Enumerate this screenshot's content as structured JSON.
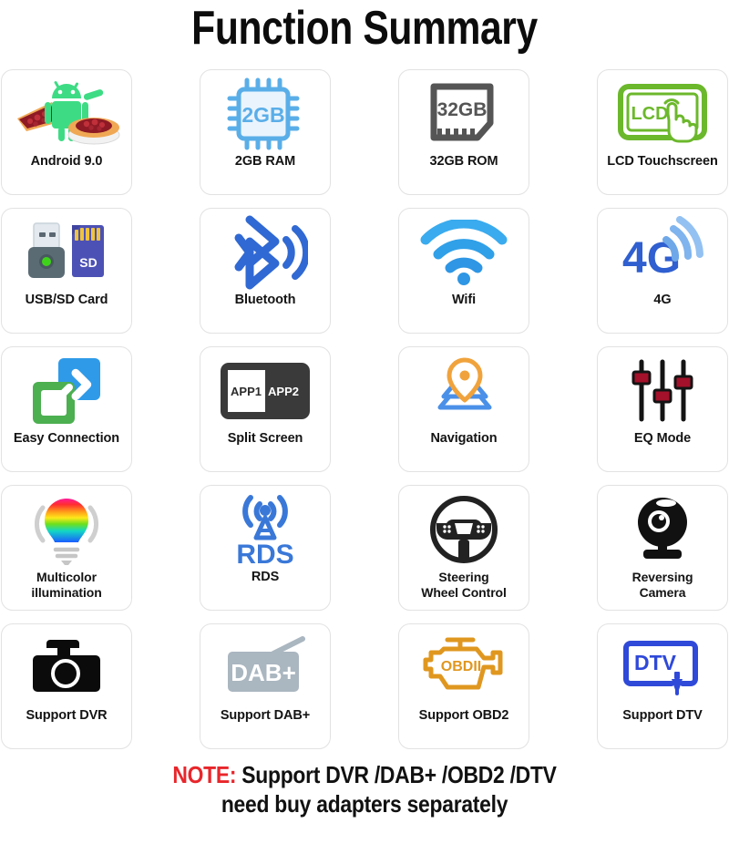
{
  "header": {
    "title": "Function Summary"
  },
  "features": [
    {
      "id": "android",
      "icon": "android-pie-icon",
      "label": "Android 9.0",
      "icon_text": "",
      "color": "#3ddc84"
    },
    {
      "id": "ram",
      "icon": "cpu-chip-icon",
      "label": "2GB RAM",
      "icon_text": "2GB",
      "color": "#5aaee8"
    },
    {
      "id": "rom",
      "icon": "sd-card-icon",
      "label": "32GB ROM",
      "icon_text": "32GB",
      "color": "#555555"
    },
    {
      "id": "lcd",
      "icon": "lcd-touchscreen-icon",
      "label": "LCD Touchscreen",
      "icon_text": "LCD",
      "color": "#6cb82c"
    },
    {
      "id": "usbsd",
      "icon": "usb-sd-card-icon",
      "label": "USB/SD Card",
      "icon_text": "SD",
      "color": "#4c51b5"
    },
    {
      "id": "bluetooth",
      "icon": "bluetooth-icon",
      "label": "Bluetooth",
      "icon_text": "",
      "color": "#3069d3"
    },
    {
      "id": "wifi",
      "icon": "wifi-icon",
      "label": "Wifi",
      "icon_text": "",
      "color": "#30a0e8"
    },
    {
      "id": "4g",
      "icon": "4g-signal-icon",
      "label": "4G",
      "icon_text": "4G",
      "color": "#2f5fd0"
    },
    {
      "id": "easyconn",
      "icon": "easy-connection-icon",
      "label": "Easy Connection",
      "icon_text": "",
      "color": "#4caf50"
    },
    {
      "id": "split",
      "icon": "split-screen-icon",
      "label": "Split Screen",
      "icon_text": "APP1 APP2",
      "color": "#3a3a3a"
    },
    {
      "id": "navigation",
      "icon": "navigation-pin-icon",
      "label": "Navigation",
      "icon_text": "",
      "color": "#f0a33c"
    },
    {
      "id": "eq",
      "icon": "eq-sliders-icon",
      "label": "EQ Mode",
      "icon_text": "",
      "color": "#a4112a"
    },
    {
      "id": "multicolor",
      "icon": "multicolor-bulb-icon",
      "label": "Multicolor\nillumination",
      "icon_text": "",
      "color": "#ff2fa0"
    },
    {
      "id": "rds",
      "icon": "rds-tower-icon",
      "label": "RDS",
      "icon_text": "RDS",
      "color": "#3a78d8"
    },
    {
      "id": "steering",
      "icon": "steering-wheel-icon",
      "label": "Steering\nWheel Control",
      "icon_text": "",
      "color": "#222222"
    },
    {
      "id": "reversing",
      "icon": "reversing-camera-icon",
      "label": "Reversing\nCamera",
      "icon_text": "",
      "color": "#111111"
    },
    {
      "id": "dvr",
      "icon": "dvr-dashcam-icon",
      "label": "Support DVR",
      "icon_text": "",
      "color": "#0b0b0b"
    },
    {
      "id": "dab",
      "icon": "dab-radio-icon",
      "label": "Support DAB+",
      "icon_text": "DAB+",
      "color": "#aab6c0"
    },
    {
      "id": "obd2",
      "icon": "obd2-engine-icon",
      "label": "Support OBD2",
      "icon_text": "OBDII",
      "color": "#e0971f"
    },
    {
      "id": "dtv",
      "icon": "dtv-screen-icon",
      "label": "Support DTV",
      "icon_text": "DTV",
      "color": "#2f49d8"
    }
  ],
  "note": {
    "prefix": "NOTE:",
    "line1": "Support DVR /DAB+ /OBD2 /DTV",
    "line2": "need buy adapters separately",
    "prefix_color": "#e8262b"
  }
}
